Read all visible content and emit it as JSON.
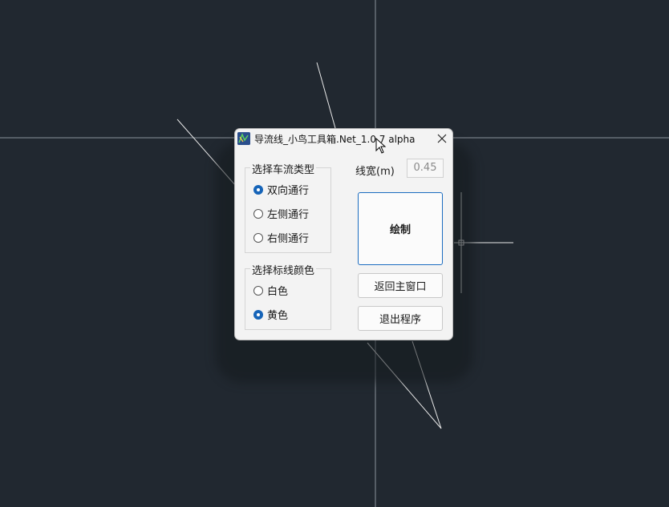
{
  "dialog": {
    "title": "导流线_小鸟工具箱.Net_1.0.7 alpha",
    "icons": {
      "app": "app-icon",
      "close": "close-icon"
    }
  },
  "traffic_type": {
    "legend": "选择车流类型",
    "options": [
      {
        "label": "双向通行",
        "checked": true
      },
      {
        "label": "左侧通行",
        "checked": false
      },
      {
        "label": "右侧通行",
        "checked": false
      }
    ]
  },
  "line_color": {
    "legend": "选择标线颜色",
    "options": [
      {
        "label": "白色",
        "checked": false
      },
      {
        "label": "黄色",
        "checked": true
      }
    ]
  },
  "line_width": {
    "label": "线宽(m)",
    "value": "0.45"
  },
  "buttons": {
    "draw": "绘制",
    "return_main": "返回主窗口",
    "exit": "退出程序"
  },
  "colors": {
    "canvas_bg": "#212830",
    "dialog_bg": "#f3f3f3",
    "accent": "#1664b8",
    "drawing_lines": "#ffffff"
  }
}
